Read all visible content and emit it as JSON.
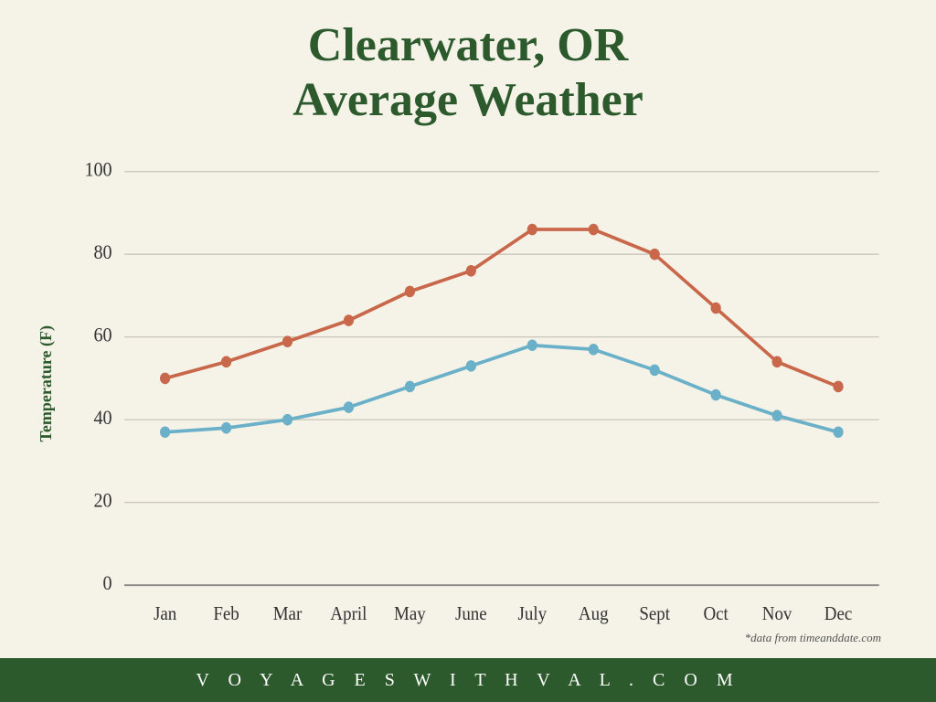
{
  "title": {
    "line1": "Clearwater, OR",
    "line2": "Average Weather"
  },
  "y_axis_label": "Temperature (F)",
  "footer_text": "V O Y A G E S W I T H V A L . C O M",
  "data_source": "*data from timeanddate.com",
  "months": [
    "Jan",
    "Feb",
    "Mar",
    "April",
    "May",
    "June",
    "July",
    "Aug",
    "Sept",
    "Oct",
    "Nov",
    "Dec"
  ],
  "high_temps": [
    50,
    54,
    59,
    64,
    71,
    76,
    86,
    86,
    80,
    67,
    54,
    48
  ],
  "low_temps": [
    37,
    38,
    40,
    43,
    48,
    53,
    58,
    57,
    52,
    46,
    41,
    37
  ],
  "y_ticks": [
    0,
    20,
    40,
    60,
    80,
    100
  ],
  "colors": {
    "high_line": "#c8674a",
    "low_line": "#6ab0c8",
    "grid": "#d8d4c8",
    "axis_text": "#333",
    "title": "#2d5a2d"
  }
}
